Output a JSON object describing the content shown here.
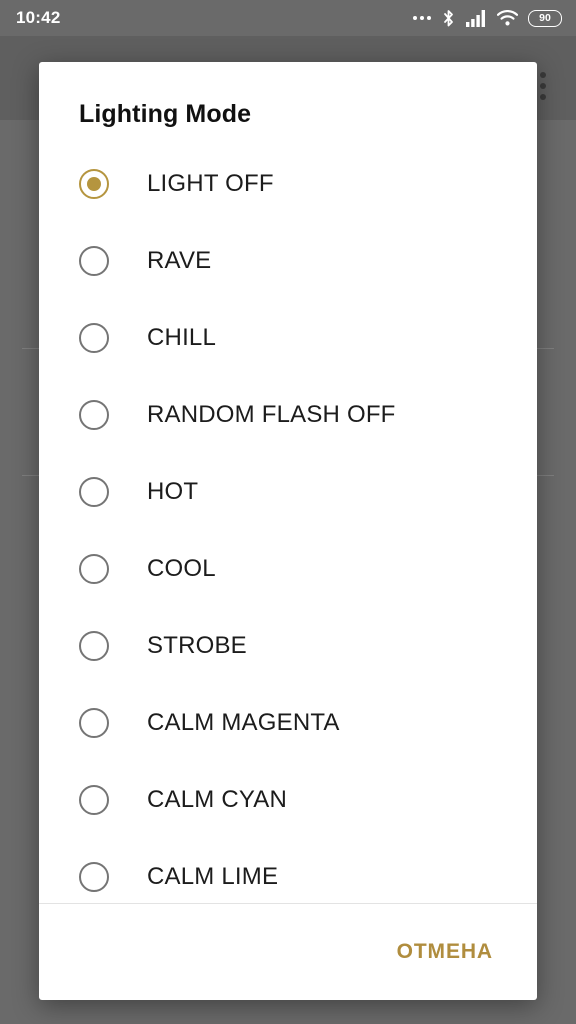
{
  "status_bar": {
    "time": "10:42",
    "icons": [
      {
        "name": "ellipsis-icon",
        "label": "more-notifications"
      },
      {
        "name": "bluetooth-icon",
        "label": "bluetooth"
      },
      {
        "name": "cellular-signal-icon",
        "label": "signal"
      },
      {
        "name": "wifi-icon",
        "label": "wifi"
      },
      {
        "name": "battery-icon",
        "label": "battery"
      }
    ],
    "battery_level": "90"
  },
  "backdrop": {
    "overflow_menu": "overflow-menu-icon"
  },
  "dialog": {
    "title": "Lighting Mode",
    "selected_index": 0,
    "options": [
      {
        "label": "LIGHT OFF"
      },
      {
        "label": "RAVE"
      },
      {
        "label": "CHILL"
      },
      {
        "label": "RANDOM FLASH OFF"
      },
      {
        "label": "HOT"
      },
      {
        "label": "COOL"
      },
      {
        "label": "STROBE"
      },
      {
        "label": "CALM MAGENTA"
      },
      {
        "label": "CALM CYAN"
      },
      {
        "label": "CALM LIME"
      }
    ],
    "cancel_label": "ОТМЕНА"
  },
  "colors": {
    "accent": "#b5953f",
    "cancel_text": "#b08d3e",
    "scrim": "#6a6a6a",
    "dialog_bg": "#ffffff",
    "radio_unselected": "#757575",
    "text_primary": "#1c1c1c"
  }
}
